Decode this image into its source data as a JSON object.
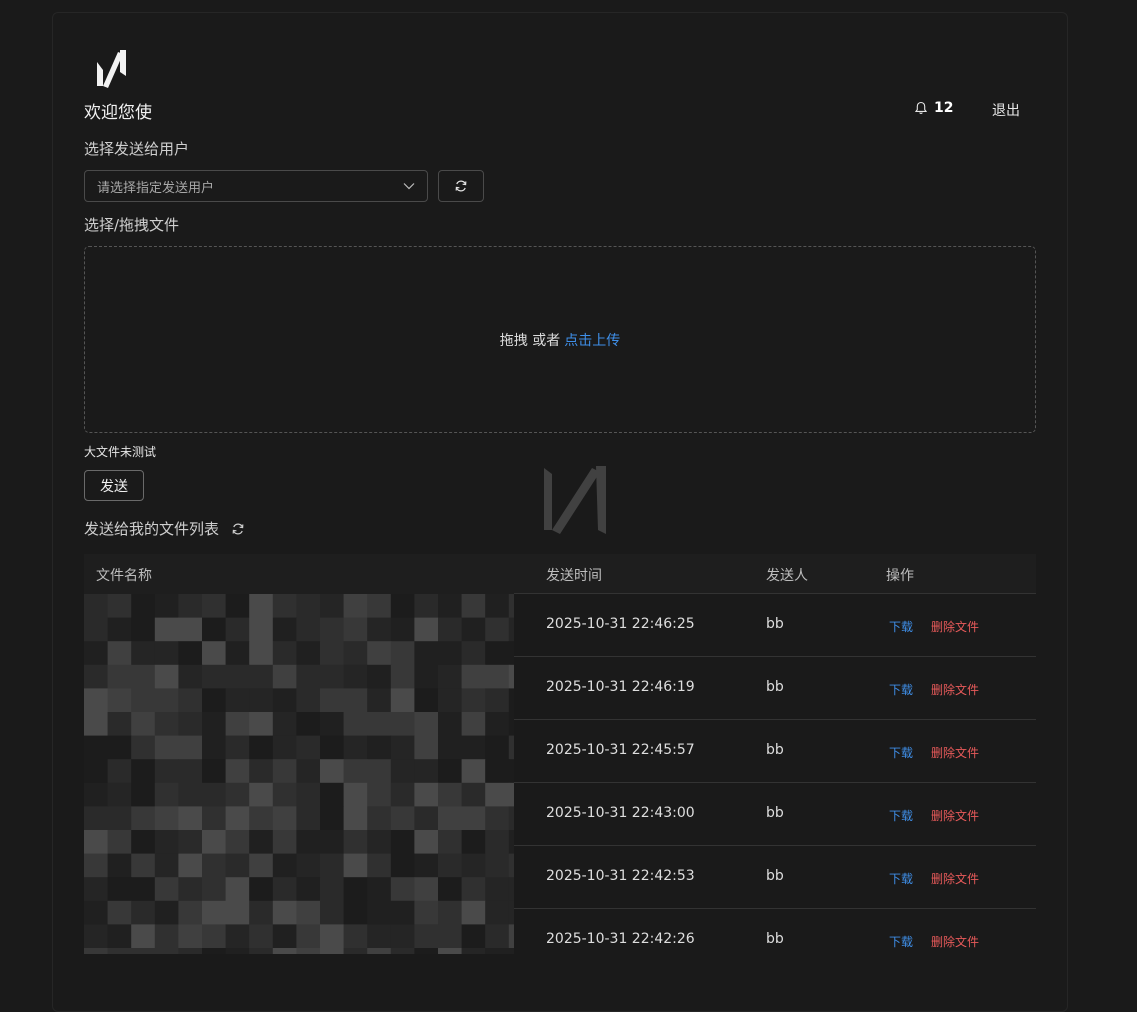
{
  "header": {
    "welcome": "欢迎您使",
    "notification_count": "12",
    "logout": "退出",
    "icons": {
      "logo": "brand-logo",
      "bell": "bell-icon"
    }
  },
  "form": {
    "select_user_label": "选择发送给用户",
    "select_placeholder": "请选择指定发送用户",
    "file_label": "选择/拖拽文件",
    "drop_text": "拖拽 或者",
    "drop_link": "点击上传",
    "note": "大文件未测试",
    "send_label": "发送"
  },
  "file_list": {
    "title": "发送给我的文件列表",
    "columns": [
      "文件名称",
      "发送时间",
      "发送人",
      "操作"
    ],
    "action_download": "下载",
    "action_delete": "删除文件",
    "rows": [
      {
        "time": "2025-10-31 22:46:25",
        "sender": "bb"
      },
      {
        "time": "2025-10-31 22:46:19",
        "sender": "bb"
      },
      {
        "time": "2025-10-31 22:45:57",
        "sender": "bb"
      },
      {
        "time": "2025-10-31 22:43:00",
        "sender": "bb"
      },
      {
        "time": "2025-10-31 22:42:53",
        "sender": "bb"
      },
      {
        "time": "2025-10-31 22:42:26",
        "sender": "bb"
      }
    ]
  },
  "colors": {
    "background": "#1a1a1a",
    "link": "#3f8fe8",
    "danger": "#e85a5a"
  }
}
